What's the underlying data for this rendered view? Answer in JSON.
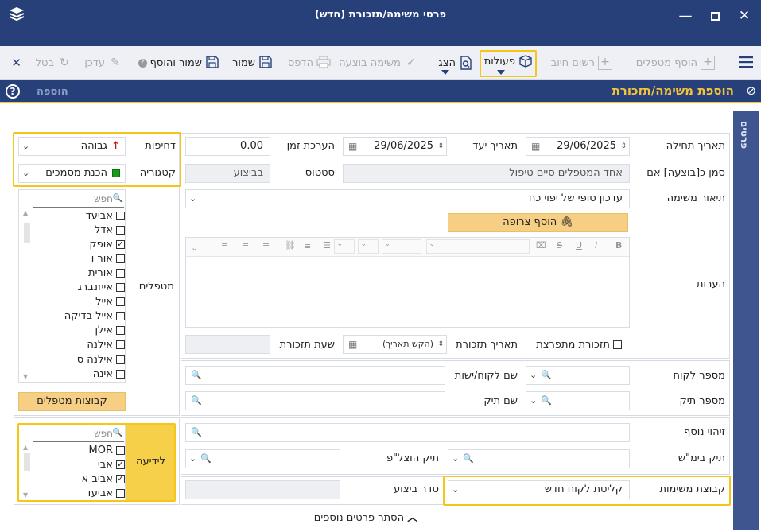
{
  "window": {
    "title": "פרטי משימה/תזכורת (חדש)"
  },
  "toolbar": {
    "menu_icon": "hamburger-icon",
    "add_handlers": "הוסף מטפלים",
    "billing_record": "רשום חיוב",
    "actions": "פעולות",
    "show": "הצג",
    "task_done": "משימה בוצעה",
    "print": "הדפס",
    "save": "שמור",
    "save_and_add": "שמור והוסף",
    "update": "עדכן",
    "cancel": "בטל",
    "close_icon": "close-icon"
  },
  "header": {
    "title": "הוספת משימה/תזכורת",
    "mode": "הוספה",
    "side_tab": "פרטים"
  },
  "form": {
    "start_date_label": "תאריך תחילה",
    "start_date": "29/06/2025",
    "due_date_label": "תאריך יעד",
    "due_date": "29/06/2025",
    "time_estimate_label": "הערכת זמן",
    "time_estimate": "0.00",
    "urgency_label": "דחיפות",
    "urgency": "גבוהה",
    "mark_done_label": "סמן כ[בוצעה] אם",
    "mark_done_value": "אחד המטפלים סיים טיפול",
    "status_label": "סטטוס",
    "status_value": "בביצוע",
    "category_label": "קטגוריה",
    "category": "הכנת מסמכים",
    "description_label": "תיאור משימה",
    "description": "עדכון סופי של יפוי כח",
    "attach_button": "הוסף צרופה",
    "notes_label": "הערות",
    "handlers_label": "מטפלים",
    "recurring_label": "תזכורת מתפרצת",
    "reminder_date_label": "תאריך תזכורת",
    "reminder_date_placeholder": "(הקש תאריך)",
    "reminder_time_label": "שעת תזכורת",
    "customer_no_label": "מספר לקוח",
    "customer_name_label": "שם לקוח/ישות",
    "case_no_label": "מספר תיק",
    "case_name_label": "שם תיק",
    "extra_id_label": "זיהוי נוסף",
    "court_case_label": "תיק בימ\"ש",
    "execution_case_label": "תיק הוצל\"פ",
    "task_groups_label": "קבוצת משימות",
    "task_groups_value": "קליטת לקוח חדש",
    "exec_order_label": "סדר ביצוע",
    "handler_groups_button": "קבוצות מטפלים",
    "hide_details": "הסתר פרטים נוספים"
  },
  "search": {
    "placeholder": "חפש"
  },
  "handlers_list": [
    {
      "name": "אביעד",
      "checked": false
    },
    {
      "name": "אדל",
      "checked": false
    },
    {
      "name": "אופק",
      "checked": true
    },
    {
      "name": "אור ו",
      "checked": false
    },
    {
      "name": "אורית",
      "checked": false
    },
    {
      "name": "אייזנברג",
      "checked": false
    },
    {
      "name": "אייל",
      "checked": false
    },
    {
      "name": "אייל בדיקה",
      "checked": false
    },
    {
      "name": "אילן",
      "checked": false
    },
    {
      "name": "אילנה",
      "checked": false
    },
    {
      "name": "אילנה ס",
      "checked": false
    },
    {
      "name": "אינה",
      "checked": false
    }
  ],
  "fyi_label": "לידיעה",
  "fyi_list": [
    {
      "name": "MOR",
      "checked": false
    },
    {
      "name": "אבי",
      "checked": true
    },
    {
      "name": "אביב א",
      "checked": true
    },
    {
      "name": "אביעד",
      "checked": false
    }
  ],
  "colors": {
    "navy": "#27407a",
    "accent_yellow": "#f3c338",
    "urgency_arrow": "#cc1111",
    "category_square": "#1a9a1a"
  }
}
